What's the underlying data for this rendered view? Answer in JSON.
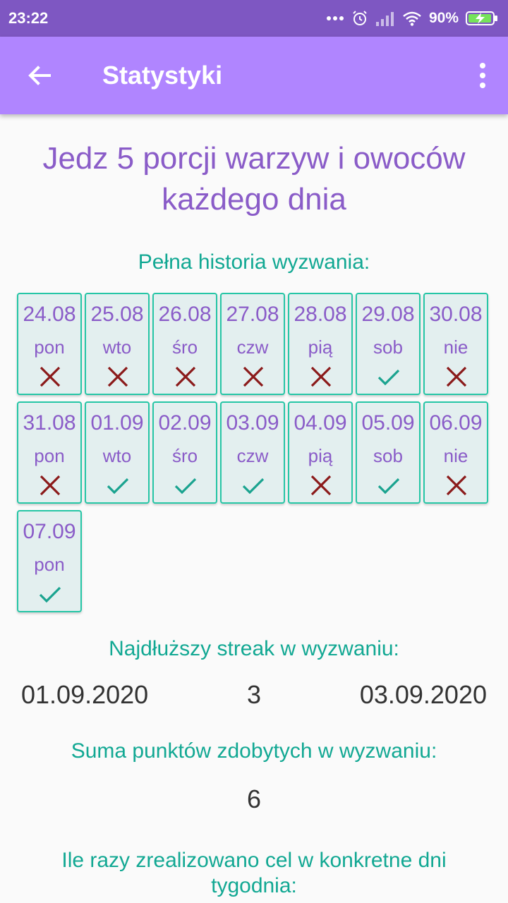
{
  "status_bar": {
    "time": "23:22",
    "battery": "90%",
    "icons": [
      "more-dots-icon",
      "alarm-icon",
      "signal-icon",
      "wifi-icon",
      "battery-charging-icon"
    ]
  },
  "app_bar": {
    "title": "Statystyki",
    "back_icon": "arrow-back-icon",
    "menu_icon": "more-vert-icon"
  },
  "challenge": {
    "title_line1": "Jedz 5 porcji warzyw i owoców",
    "title_line2": "każdego dnia"
  },
  "history": {
    "label": "Pełna historia wyzwania:",
    "days": [
      {
        "date": "24.08",
        "day": "pon",
        "done": false
      },
      {
        "date": "25.08",
        "day": "wto",
        "done": false
      },
      {
        "date": "26.08",
        "day": "śro",
        "done": false
      },
      {
        "date": "27.08",
        "day": "czw",
        "done": false
      },
      {
        "date": "28.08",
        "day": "pią",
        "done": false
      },
      {
        "date": "29.08",
        "day": "sob",
        "done": true
      },
      {
        "date": "30.08",
        "day": "nie",
        "done": false
      },
      {
        "date": "31.08",
        "day": "pon",
        "done": false
      },
      {
        "date": "01.09",
        "day": "wto",
        "done": true
      },
      {
        "date": "02.09",
        "day": "śro",
        "done": true
      },
      {
        "date": "03.09",
        "day": "czw",
        "done": true
      },
      {
        "date": "04.09",
        "day": "pią",
        "done": false
      },
      {
        "date": "05.09",
        "day": "sob",
        "done": true
      },
      {
        "date": "06.09",
        "day": "nie",
        "done": false
      },
      {
        "date": "07.09",
        "day": "pon",
        "done": true
      }
    ]
  },
  "streak": {
    "label": "Najdłuższy streak w wyzwaniu:",
    "start": "01.09.2020",
    "length": "3",
    "end": "03.09.2020"
  },
  "points": {
    "label": "Suma punktów zdobytych w wyzwaniu:",
    "value": "6"
  },
  "weekdays": {
    "label_line1": "Ile razy zrealizowano cel w konkretne dni",
    "label_line2": "tygodnia:"
  },
  "colors": {
    "status_bar": "#7e57c2",
    "app_bar": "#b085ff",
    "title": "#8a5cc8",
    "section_label": "#12a893",
    "cell_border": "#26c6a6",
    "check": "#1aa38f",
    "cross": "#8b1a1a"
  }
}
